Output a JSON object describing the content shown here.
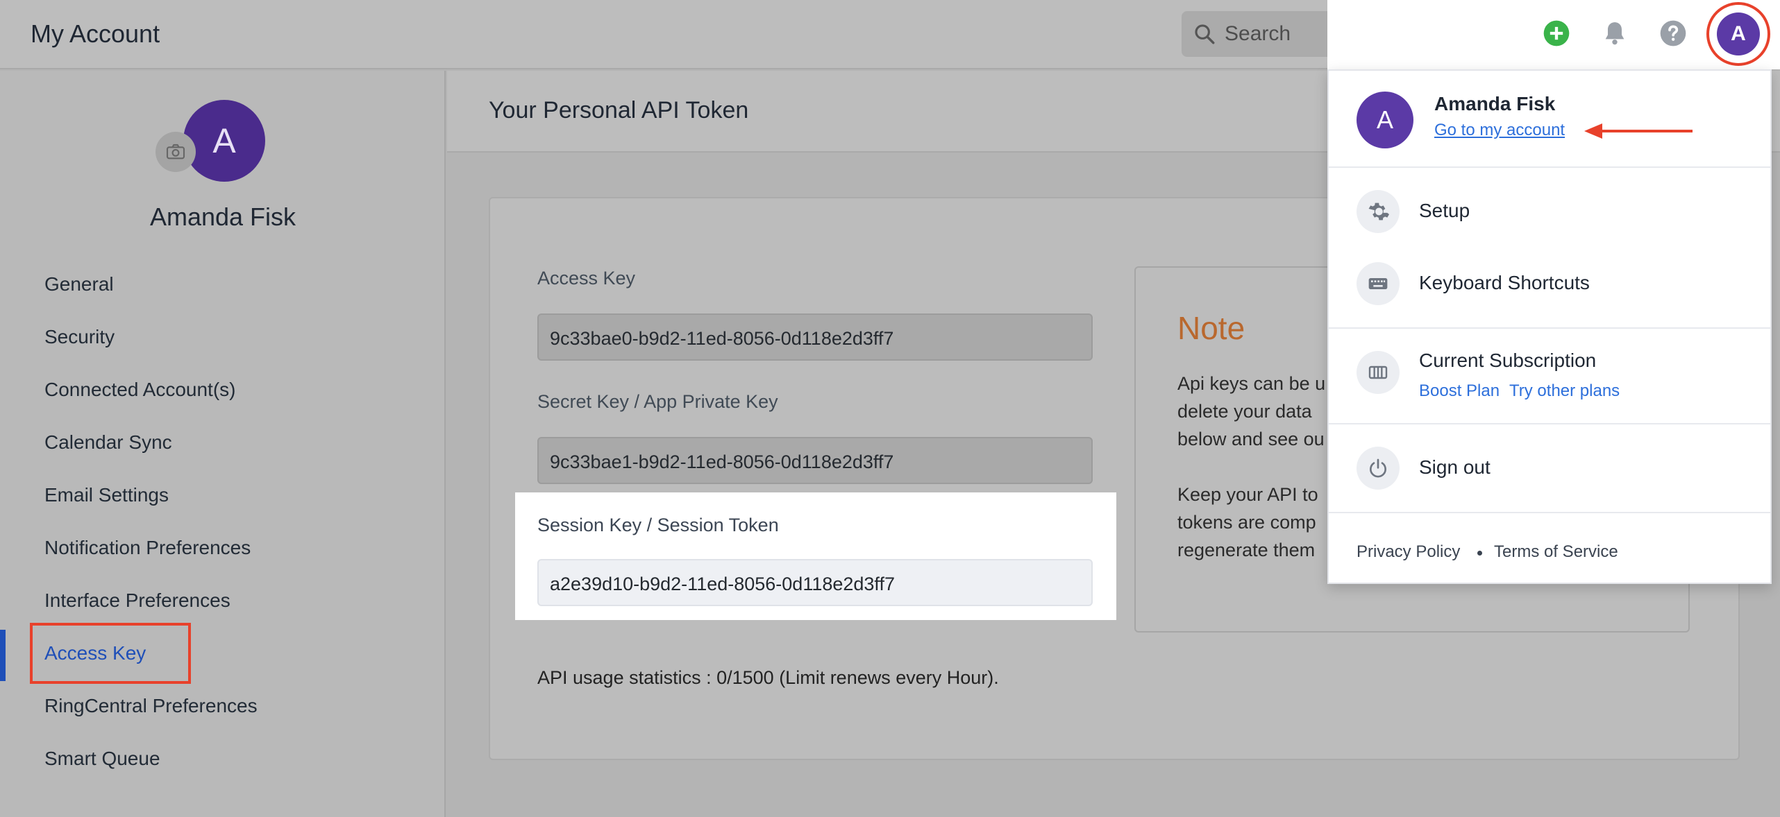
{
  "header": {
    "title": "My Account",
    "search_placeholder": "Search",
    "avatar_letter": "A"
  },
  "profile": {
    "avatar_letter": "A",
    "name": "Amanda Fisk"
  },
  "sidebar": {
    "items": [
      {
        "label": "General"
      },
      {
        "label": "Security"
      },
      {
        "label": "Connected Account(s)"
      },
      {
        "label": "Calendar Sync"
      },
      {
        "label": "Email Settings"
      },
      {
        "label": "Notification Preferences"
      },
      {
        "label": "Interface Preferences"
      },
      {
        "label": "Access Key"
      },
      {
        "label": "RingCentral Preferences"
      },
      {
        "label": "Smart Queue"
      }
    ],
    "active": "Access Key"
  },
  "main": {
    "page_title": "Your Personal API Token",
    "access_key_label": "Access Key",
    "access_key_value": "9c33bae0-b9d2-11ed-8056-0d118e2d3ff7",
    "secret_key_label": "Secret Key / App Private Key",
    "secret_key_value": "9c33bae1-b9d2-11ed-8056-0d118e2d3ff7",
    "session_key_label": "Session Key / Session Token",
    "session_key_value": "a2e39d10-b9d2-11ed-8056-0d118e2d3ff7",
    "usage": "API usage statistics : 0/1500 (Limit renews every Hour).",
    "note": {
      "title": "Note",
      "lines": [
        "Api keys can be u",
        "delete your data",
        "below and see ou",
        "Keep your API to",
        "tokens are comp",
        "regenerate them"
      ]
    }
  },
  "dropdown": {
    "avatar_letter": "A",
    "name": "Amanda Fisk",
    "account_link": "Go to my account",
    "setup": "Setup",
    "shortcuts": "Keyboard Shortcuts",
    "subscription": "Current Subscription",
    "plan": "Boost Plan",
    "try_plans": "Try other plans",
    "sign_out": "Sign out",
    "privacy": "Privacy Policy",
    "terms": "Terms of Service"
  },
  "colors": {
    "accent_blue": "#2d6fdb",
    "avatar_purple": "#5b3aa6",
    "highlight_red": "#e8412b",
    "note_orange": "#b9682e",
    "add_green": "#3ab34a"
  },
  "icons": [
    "search-icon",
    "add-icon",
    "bell-icon",
    "help-icon",
    "camera-icon",
    "gear-icon",
    "keyboard-icon",
    "subscription-icon",
    "power-icon",
    "arrow-icon"
  ]
}
